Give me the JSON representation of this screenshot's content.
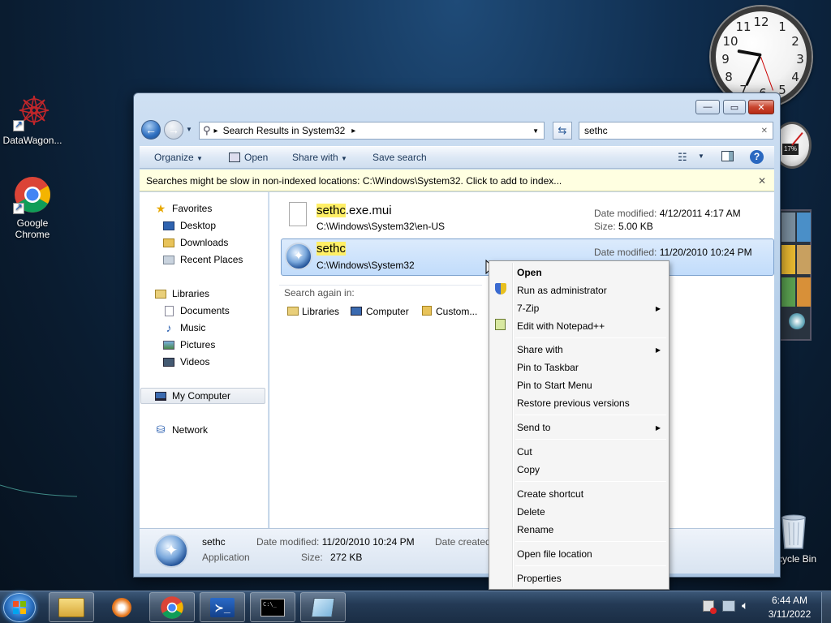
{
  "desktop": {
    "icons": [
      {
        "label": "DataWagon...",
        "icon": "datawagon-icon"
      },
      {
        "label": "Google Chrome",
        "icon": "chrome-icon"
      },
      {
        "label": "cycle Bin",
        "icon": "recycle-bin-icon"
      }
    ]
  },
  "gadgets": {
    "clock_numbers": [
      "12",
      "1",
      "2",
      "3",
      "4",
      "5",
      "6",
      "7",
      "8",
      "9",
      "10",
      "11"
    ],
    "cpu_label": "17%"
  },
  "window": {
    "controls": {
      "minimize": "—",
      "maximize": "▭",
      "close": "✕"
    },
    "address": {
      "crumb_arrow": "▸",
      "path": "Search Results in System32",
      "crumb_end": "▸"
    },
    "search_value": "sethc",
    "search_clear": "✕",
    "toolbar": {
      "organize": "Organize",
      "open": "Open",
      "share_with": "Share with",
      "save_search": "Save search"
    },
    "infobar": {
      "text": "Searches might be slow in non-indexed locations: C:\\Windows\\System32. Click to add to index...",
      "close": "✕"
    },
    "nav": {
      "favorites": "Favorites",
      "desktop": "Desktop",
      "downloads": "Downloads",
      "recent": "Recent Places",
      "libraries": "Libraries",
      "documents": "Documents",
      "music": "Music",
      "pictures": "Pictures",
      "videos": "Videos",
      "computer": "My Computer",
      "network": "Network"
    },
    "results": [
      {
        "name_hl": "sethc",
        "name_rest": ".exe.mui",
        "path": "C:\\Windows\\System32\\en-US",
        "modified_label": "Date modified:",
        "modified": "4/12/2011 4:17 AM",
        "size_label": "Size:",
        "size": "5.00 KB"
      },
      {
        "name_hl": "sethc",
        "name_rest": "",
        "path": "C:\\Windows\\System32",
        "modified_label": "Date modified:",
        "modified": "11/20/2010 10:24 PM"
      }
    ],
    "search_again": {
      "label": "Search again in:",
      "libraries": "Libraries",
      "computer": "Computer",
      "custom": "Custom..."
    },
    "details": {
      "name": "sethc",
      "type": "Application",
      "modified_label": "Date modified:",
      "modified": "11/20/2010 10:24 PM",
      "size_label": "Size:",
      "size": "272 KB",
      "created_label": "Date created:"
    }
  },
  "context_menu": {
    "open": "Open",
    "run_admin": "Run as administrator",
    "zip": "7-Zip",
    "notepadpp": "Edit with Notepad++",
    "share_with": "Share with",
    "pin_taskbar": "Pin to Taskbar",
    "pin_start": "Pin to Start Menu",
    "restore": "Restore previous versions",
    "send_to": "Send to",
    "cut": "Cut",
    "copy": "Copy",
    "create_shortcut": "Create shortcut",
    "delete": "Delete",
    "rename": "Rename",
    "open_location": "Open file location",
    "properties": "Properties"
  },
  "taskbar": {
    "clock_time": "6:44 AM",
    "clock_date": "3/11/2022",
    "cmd_text": "C:\\_"
  }
}
